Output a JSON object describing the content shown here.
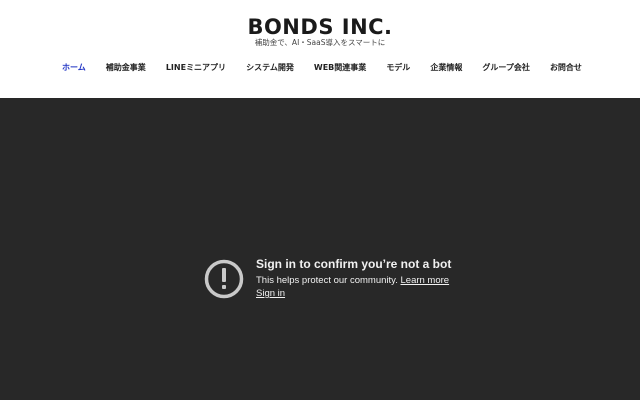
{
  "header": {
    "logo_text": "BONDS INC.",
    "tagline": "補助金で、AI・SaaS導入をスマートに"
  },
  "nav": {
    "active_color": "#1f33c4",
    "items": [
      {
        "label": "ホーム",
        "active": true
      },
      {
        "label": "補助金事業",
        "active": false
      },
      {
        "label": "LINEミニアプリ",
        "active": false
      },
      {
        "label": "システム開発",
        "active": false
      },
      {
        "label": "WEB関連事業",
        "active": false
      },
      {
        "label": "モデル",
        "active": false
      },
      {
        "label": "企業情報",
        "active": false
      },
      {
        "label": "グループ会社",
        "active": false
      },
      {
        "label": "お問合せ",
        "active": false
      }
    ]
  },
  "video": {
    "background": "#282828",
    "icon": "alert-circle-icon",
    "title": "Sign in to confirm you’re not a bot",
    "body_text": "This helps protect our community.",
    "learn_more": "Learn more",
    "sign_in": "Sign in"
  }
}
